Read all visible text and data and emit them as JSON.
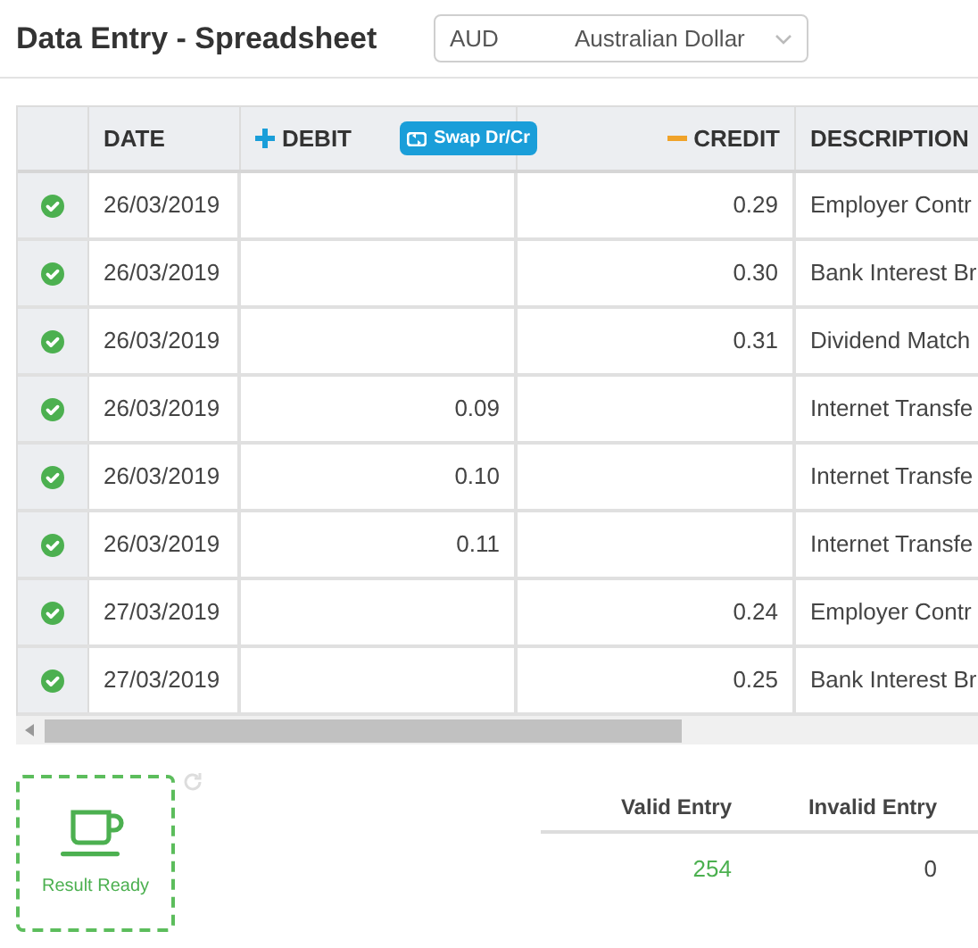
{
  "title": "Data Entry - Spreadsheet",
  "currency": {
    "code": "AUD",
    "name": "Australian Dollar"
  },
  "table": {
    "columns": [
      {
        "label": "DATE",
        "kind": "plain"
      },
      {
        "label": "DEBIT",
        "kind": "debit"
      },
      {
        "label": "CREDIT",
        "kind": "credit"
      },
      {
        "label": "DESCRIPTION",
        "kind": "plain"
      }
    ],
    "swap_button": "Swap Dr/Cr",
    "rows": [
      {
        "valid": true,
        "date": "26/03/2019",
        "debit": "",
        "credit": "0.29",
        "description": "Employer Contr"
      },
      {
        "valid": true,
        "date": "26/03/2019",
        "debit": "",
        "credit": "0.30",
        "description": "Bank Interest Br"
      },
      {
        "valid": true,
        "date": "26/03/2019",
        "debit": "",
        "credit": "0.31",
        "description": "Dividend Match"
      },
      {
        "valid": true,
        "date": "26/03/2019",
        "debit": "0.09",
        "credit": "",
        "description": "Internet Transfe"
      },
      {
        "valid": true,
        "date": "26/03/2019",
        "debit": "0.10",
        "credit": "",
        "description": "Internet Transfe"
      },
      {
        "valid": true,
        "date": "26/03/2019",
        "debit": "0.11",
        "credit": "",
        "description": "Internet Transfe"
      },
      {
        "valid": true,
        "date": "27/03/2019",
        "debit": "",
        "credit": "0.24",
        "description": "Employer Contr"
      },
      {
        "valid": true,
        "date": "27/03/2019",
        "debit": "",
        "credit": "0.25",
        "description": "Bank Interest Br"
      }
    ]
  },
  "result": {
    "label": "Result Ready"
  },
  "summary": {
    "columns": [
      "Valid Entry",
      "Invalid Entry"
    ],
    "values": [
      "254",
      "0"
    ]
  }
}
